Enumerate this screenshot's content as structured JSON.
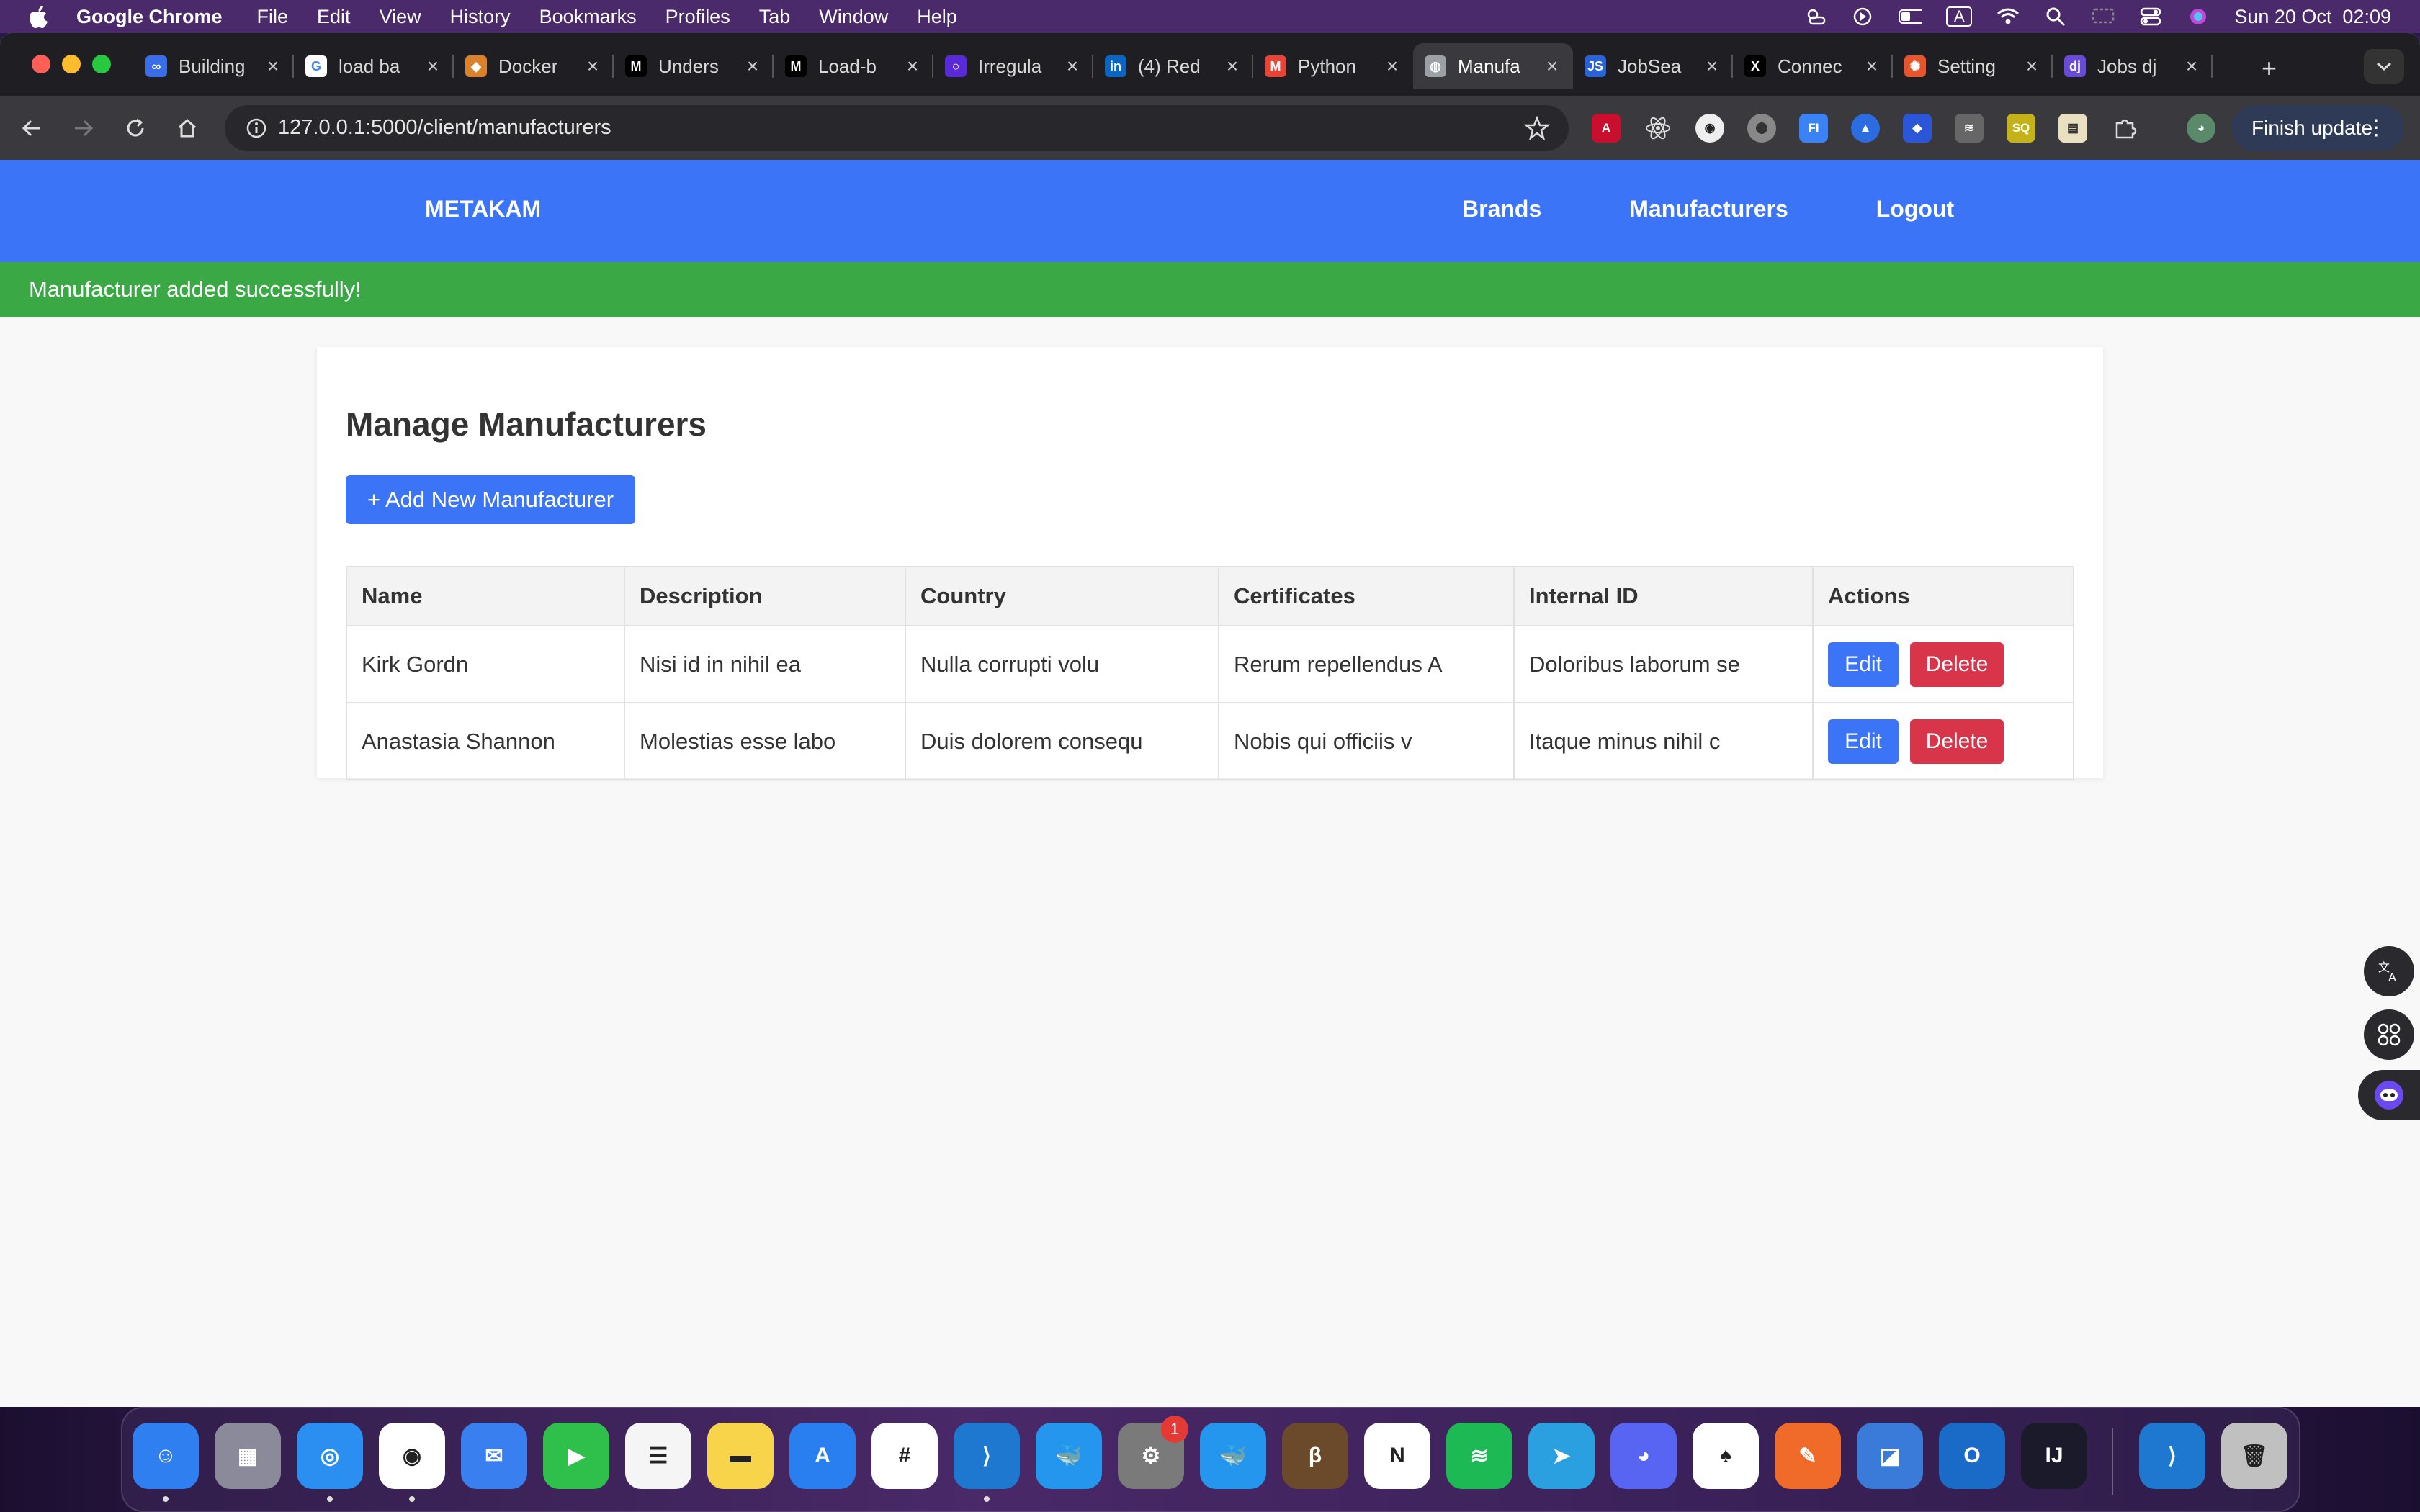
{
  "menubar": {
    "app": "Google Chrome",
    "items": [
      "File",
      "Edit",
      "View",
      "History",
      "Bookmarks",
      "Profiles",
      "Tab",
      "Window",
      "Help"
    ],
    "input_indicator": "A",
    "clock": "Sun 20 Oct  02:09"
  },
  "browser": {
    "tabs": [
      {
        "title": "Building",
        "icon": "infinity-icon",
        "color": "#3a6ee8"
      },
      {
        "title": "load ba",
        "icon": "google-icon",
        "color": "#ffffff"
      },
      {
        "title": "Docker",
        "icon": "docker-icon",
        "color": "#d9822b"
      },
      {
        "title": "Unders",
        "icon": "medium-icon",
        "color": "#000000"
      },
      {
        "title": "Load-b",
        "icon": "medium-icon",
        "color": "#000000"
      },
      {
        "title": "Irregula",
        "icon": "circle-icon",
        "color": "#5b2ad8"
      },
      {
        "title": "(4) Red",
        "icon": "linkedin-icon",
        "color": "#0a66c2"
      },
      {
        "title": "Python",
        "icon": "gmail-icon",
        "color": "#ea4335"
      },
      {
        "title": "Manufa",
        "icon": "globe-icon",
        "color": "#9aa0a6"
      },
      {
        "title": "JobSea",
        "icon": "js-icon",
        "color": "#2a62d8"
      },
      {
        "title": "Connec",
        "icon": "x-logo-icon",
        "color": "#000000"
      },
      {
        "title": "Setting",
        "icon": "settings-icon",
        "color": "#e8542b"
      },
      {
        "title": "Jobs dj",
        "icon": "django-icon",
        "color": "#6a4ad8"
      }
    ],
    "active_tab": 8,
    "url": "127.0.0.1:5000/client/manufacturers",
    "finish_update": "Finish update"
  },
  "site": {
    "brand": "METAKAM",
    "nav": [
      "Brands",
      "Manufacturers",
      "Logout"
    ],
    "flash": "Manufacturer added successfully!",
    "page_title": "Manage Manufacturers",
    "add_button": "+ Add New Manufacturer",
    "table": {
      "headers": [
        "Name",
        "Description",
        "Country",
        "Certificates",
        "Internal ID",
        "Actions"
      ],
      "rows": [
        [
          "Kirk Gordn",
          "Nisi id in nihil ea",
          "Nulla corrupti volu",
          "Rerum repellendus A",
          "Doloribus laborum se"
        ],
        [
          "Anastasia Shannon",
          "Molestias esse labo",
          "Duis dolorem consequ",
          "Nobis qui officiis v",
          "Itaque minus nihil c"
        ]
      ],
      "edit_label": "Edit",
      "delete_label": "Delete"
    }
  },
  "dock": {
    "settings_badge": "1",
    "apps": [
      "Finder",
      "Launchpad",
      "Safari",
      "Google Chrome",
      "Mail",
      "FaceTime",
      "Reminders",
      "Notes",
      "App Store",
      "Slack",
      "Visual Studio Code",
      "Docker",
      "System Settings",
      "Docker",
      "DBeaver",
      "Notion",
      "Spotify",
      "Telegram",
      "Discord",
      "MongoDB Compass",
      "Postman",
      "Preview",
      "Outlook",
      "IntelliJ IDEA",
      "Visual Studio Code",
      "Trash"
    ]
  },
  "colors": {
    "primary": "#3b74f7",
    "success": "#3aa845",
    "danger": "#d8354a"
  }
}
